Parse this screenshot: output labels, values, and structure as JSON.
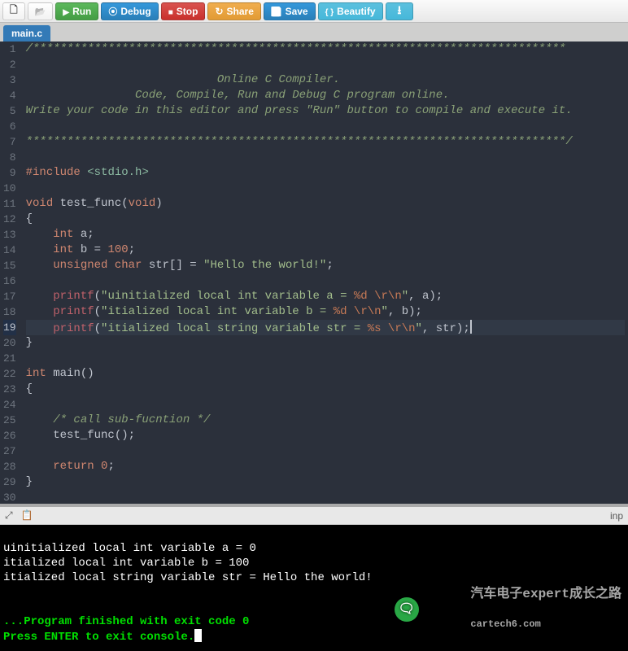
{
  "toolbar": {
    "new_label": "",
    "open_label": "",
    "run_label": "Run",
    "debug_label": "Debug",
    "stop_label": "Stop",
    "share_label": "Share",
    "save_label": "Save",
    "beautify_label": "Beautify",
    "download_label": ""
  },
  "tab": {
    "name": "main.c"
  },
  "code": {
    "lines": [
      {
        "n": 1,
        "html": "<span class='c-cm'>/******************************************************************************</span>"
      },
      {
        "n": 2,
        "html": ""
      },
      {
        "n": 3,
        "html": "<span class='c-cm'>                            Online C Compiler.</span>"
      },
      {
        "n": 4,
        "html": "<span class='c-cm'>                Code, Compile, Run and Debug C program online.</span>"
      },
      {
        "n": 5,
        "html": "<span class='c-cm'>Write your code in this editor and press \"Run\" button to compile and execute it.</span>"
      },
      {
        "n": 6,
        "html": ""
      },
      {
        "n": 7,
        "html": "<span class='c-cm'>*******************************************************************************/</span>"
      },
      {
        "n": 8,
        "html": ""
      },
      {
        "n": 9,
        "html": "<span class='c-pre'>#include</span> <span class='c-inc'>&lt;stdio.h&gt;</span>"
      },
      {
        "n": 10,
        "html": ""
      },
      {
        "n": 11,
        "html": "<span class='c-ty'>void</span> <span class='c-fn'>test_func</span>(<span class='c-ty'>void</span>)"
      },
      {
        "n": 12,
        "html": "{"
      },
      {
        "n": 13,
        "html": "    <span class='c-ty'>int</span> a;"
      },
      {
        "n": 14,
        "html": "    <span class='c-ty'>int</span> b <span class='c-op'>=</span> <span class='c-num'>100</span>;"
      },
      {
        "n": 15,
        "html": "    <span class='c-ty'>unsigned</span> <span class='c-ty'>char</span> str[] <span class='c-op'>=</span> <span class='c-str'>\"Hello the world!\"</span>;"
      },
      {
        "n": 16,
        "html": ""
      },
      {
        "n": 17,
        "html": "    <span class='c-pf'>printf</span>(<span class='c-str'>\"uinitialized local int variable a = </span><span class='c-esc'>%d</span><span class='c-str'> </span><span class='c-esc'>\\r\\n</span><span class='c-str'>\"</span>, a);"
      },
      {
        "n": 18,
        "html": "    <span class='c-pf'>printf</span>(<span class='c-str'>\"itialized local int variable b = </span><span class='c-esc'>%d</span><span class='c-str'> </span><span class='c-esc'>\\r\\n</span><span class='c-str'>\"</span>, b);"
      },
      {
        "n": 19,
        "html": "    <span class='c-pf'>printf</span>(<span class='c-str'>\"itialized local string variable str = </span><span class='c-esc'>%s</span><span class='c-str'> </span><span class='c-esc'>\\r\\n</span><span class='c-str'>\"</span>, str);<span class='cursor'></span>",
        "active": true
      },
      {
        "n": 20,
        "html": "}"
      },
      {
        "n": 21,
        "html": ""
      },
      {
        "n": 22,
        "html": "<span class='c-ty'>int</span> <span class='c-fn'>main</span>()"
      },
      {
        "n": 23,
        "html": "{"
      },
      {
        "n": 24,
        "html": ""
      },
      {
        "n": 25,
        "html": "    <span class='c-cm'>/* call sub-fucntion */</span>"
      },
      {
        "n": 26,
        "html": "    test_func();"
      },
      {
        "n": 27,
        "html": ""
      },
      {
        "n": 28,
        "html": "    <span class='c-kw'>return</span> <span class='c-num'>0</span>;"
      },
      {
        "n": 29,
        "html": "}"
      },
      {
        "n": 30,
        "html": ""
      }
    ]
  },
  "term_toolbar": {
    "expand_icon": "⤢",
    "copy_icon": "📋",
    "right_label": "inp"
  },
  "terminal": {
    "out1": "uinitialized local int variable a = 0 ",
    "out2": "itialized local int variable b = 100 ",
    "out3": "itialized local string variable str = Hello the world! ",
    "blank1": "",
    "blank2": "",
    "exit": "...Program finished with exit code 0",
    "prompt": "Press ENTER to exit console."
  },
  "watermark": {
    "text1": "汽车电子expert成长之路",
    "text2": "cartech6.com"
  }
}
